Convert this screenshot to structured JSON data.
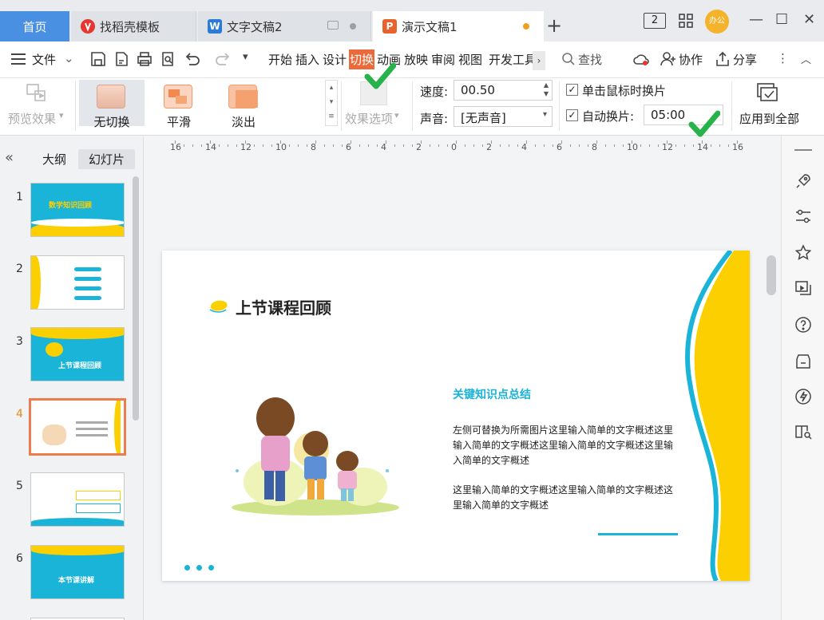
{
  "tabs": {
    "home": "首页",
    "items": [
      {
        "label": "找稻壳模板",
        "icon": "daoke-icon",
        "color": "#e8352f"
      },
      {
        "label": "文字文稿2",
        "icon": "wps-writer-icon",
        "color": "#2b7bd8"
      },
      {
        "label": "演示文稿1",
        "icon": "wps-presentation-icon",
        "color": "#e8622e"
      }
    ],
    "new_tab": "+"
  },
  "window": {
    "page_indicator": "2",
    "avatar_text": "办公",
    "minimize": "—",
    "maximize": "☐",
    "close": "✕"
  },
  "menu": {
    "file": "文件",
    "items": [
      "开始",
      "插入",
      "设计",
      "切换",
      "动画",
      "放映",
      "审阅",
      "视图",
      "开发工具"
    ],
    "active": "切换",
    "search": "查找",
    "collaborate": "协作",
    "share": "分享"
  },
  "ribbon": {
    "preview": "预览效果",
    "effects": [
      "无切换",
      "平滑",
      "淡出"
    ],
    "effect_options": "效果选项",
    "speed_label": "速度:",
    "speed_value": "00.50",
    "sound_label": "声音:",
    "sound_value": "[无声音]",
    "on_click_label": "单击鼠标时换片",
    "on_click_checked": true,
    "auto_label": "自动换片:",
    "auto_checked": true,
    "auto_value": "05:00",
    "apply_all": "应用到全部"
  },
  "left_panel": {
    "outline": "大纲",
    "slides": "幻灯片",
    "collapse": "«",
    "slide_numbers": [
      "1",
      "2",
      "3",
      "4",
      "5",
      "6"
    ],
    "selected": "4",
    "thumb_texts": {
      "s1": "数学知识回顾",
      "s3": "上节课程回顾",
      "s6": "本节课讲解"
    }
  },
  "ruler": {
    "ticks": [
      "16",
      "14",
      "12",
      "10",
      "8",
      "6",
      "4",
      "2",
      "0",
      "2",
      "4",
      "6",
      "8",
      "10",
      "12",
      "14",
      "16"
    ]
  },
  "slide": {
    "title": "上节课程回顾",
    "subtitle": "关键知识点总结",
    "para1": "左侧可替换为所需图片这里输入简单的文字概述这里输入简单的文字概述这里输入简单的文字概述这里输入简单的文字概述",
    "para2": "这里输入简单的文字概述这里输入简单的文字概述这里输入简单的文字概述",
    "accent_yellow": "#fcd000",
    "accent_blue": "#1ab4d9"
  },
  "colors": {
    "tab_home": "#4a90e2",
    "active_menu": "#ea6a3b",
    "check_green": "#27b24a",
    "selected_thumb_border": "#ee7b4b"
  }
}
